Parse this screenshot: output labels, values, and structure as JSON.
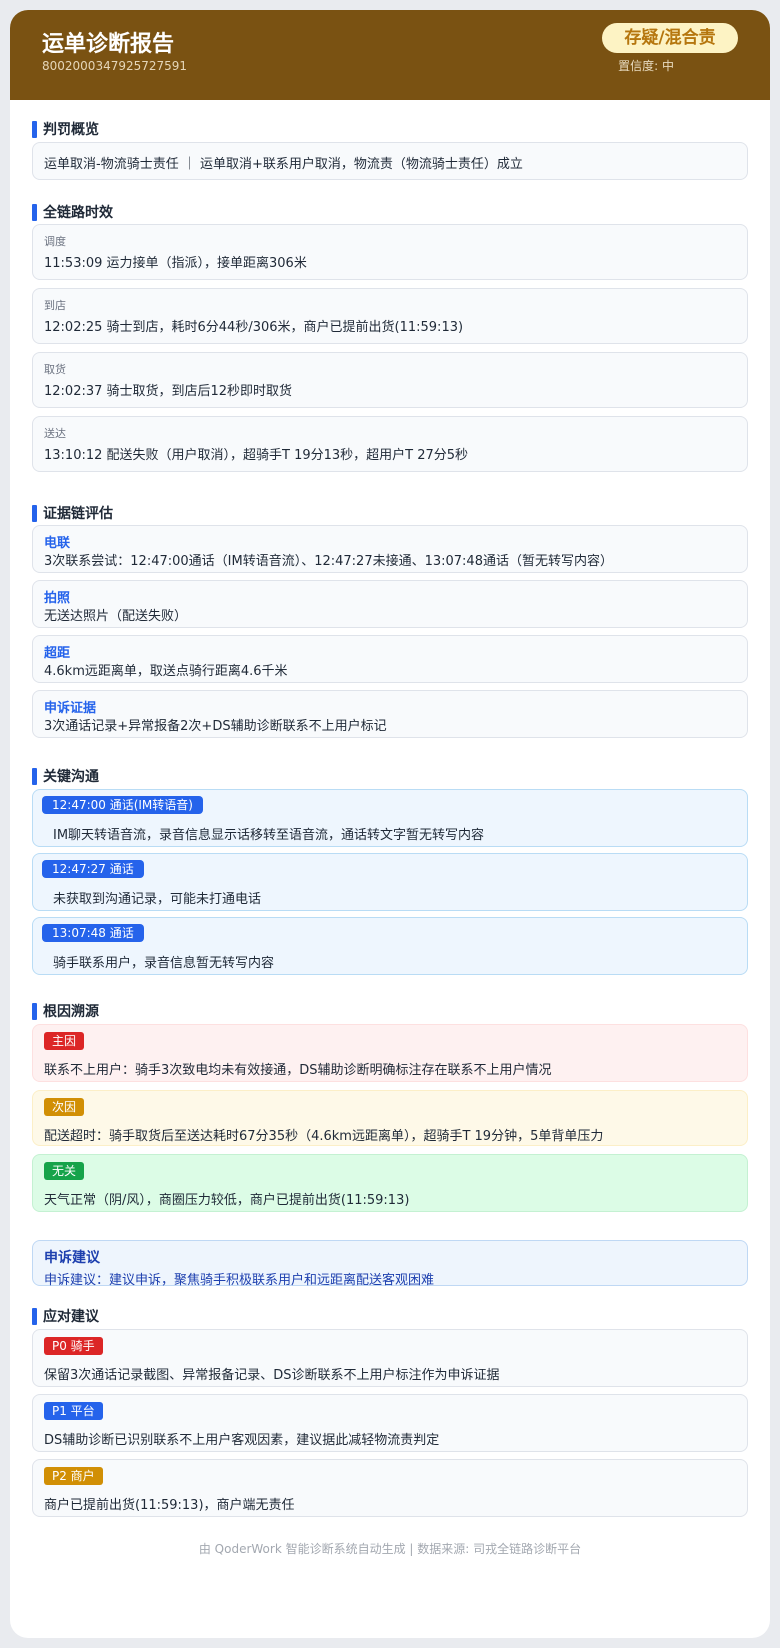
{
  "header": {
    "title": "运单诊断报告",
    "order_id": "8002000347925727591",
    "badge": "存疑/混合责",
    "confidence": "置信度: 中"
  },
  "penalty": {
    "heading": "判罚概览",
    "text": "运单取消-物流骑士责任 ｜ 运单取消+联系用户取消，物流责（物流骑士责任）成立"
  },
  "timeline": {
    "heading": "全链路时效",
    "items": [
      {
        "label": "调度",
        "text": "11:53:09 运力接单（指派），接单距离306米"
      },
      {
        "label": "到店",
        "text": "12:02:25 骑士到店，耗时6分44秒/306米，商户已提前出货(11:59:13)"
      },
      {
        "label": "取货",
        "text": "12:02:37 骑士取货，到店后12秒即时取货"
      },
      {
        "label": "送达",
        "text": "13:10:12 配送失败（用户取消），超骑手T 19分13秒，超用户T 27分5秒"
      }
    ]
  },
  "evidence": {
    "heading": "证据链评估",
    "items": [
      {
        "label": "电联",
        "text": "3次联系尝试：12:47:00通话（IM转语音流）、12:47:27未接通、13:07:48通话（暂无转写内容）"
      },
      {
        "label": "拍照",
        "text": "无送达照片（配送失败）"
      },
      {
        "label": "超距",
        "text": "4.6km远距离单，取送点骑行距离4.6千米"
      },
      {
        "label": "申诉证据",
        "text": "3次通话记录+异常报备2次+DS辅助诊断联系不上用户标记"
      }
    ]
  },
  "comms": {
    "heading": "关键沟通",
    "items": [
      {
        "tag": "12:47:00  通话(IM转语音)",
        "text": "IM聊天转语音流，录音信息显示话移转至语音流，通话转文字暂无转写内容"
      },
      {
        "tag": "12:47:27  通话",
        "text": "未获取到沟通记录，可能未打通电话"
      },
      {
        "tag": "13:07:48  通话",
        "text": "骑手联系用户，录音信息暂无转写内容"
      }
    ]
  },
  "rootcause": {
    "heading": "根因溯源",
    "items": [
      {
        "tag": "主因",
        "text": "联系不上用户：骑手3次致电均未有效接通，DS辅助诊断明确标注存在联系不上用户情况"
      },
      {
        "tag": "次因",
        "text": "配送超时：骑手取货后至送达耗时67分35秒（4.6km远距离单），超骑手T 19分钟，5单背单压力"
      },
      {
        "tag": "无关",
        "text": "天气正常（阴/风），商圈压力较低，商户已提前出货(11:59:13)"
      }
    ]
  },
  "appeal": {
    "title": "申诉建议",
    "text": "申诉建议：建议申诉，聚焦骑手积极联系用户和远距离配送客观困难"
  },
  "actions": {
    "heading": "应对建议",
    "items": [
      {
        "tag": "P0 骑手",
        "text": "保留3次通话记录截图、异常报备记录、DS诊断联系不上用户标注作为申诉证据"
      },
      {
        "tag": "P1 平台",
        "text": "DS辅助诊断已识别联系不上用户客观因素，建议据此减轻物流责判定"
      },
      {
        "tag": "P2 商户",
        "text": "商户已提前出货(11:59:13)，商户端无责任"
      }
    ]
  },
  "footer": "由 QoderWork 智能诊断系统自动生成 | 数据来源: 司戎全链路诊断平台",
  "colors": {
    "header_bg": "#7a5212",
    "accent": "#2563eb",
    "primary_cause": "#dc2626",
    "secondary_cause": "#d18f05",
    "unrelated": "#16a34a"
  }
}
